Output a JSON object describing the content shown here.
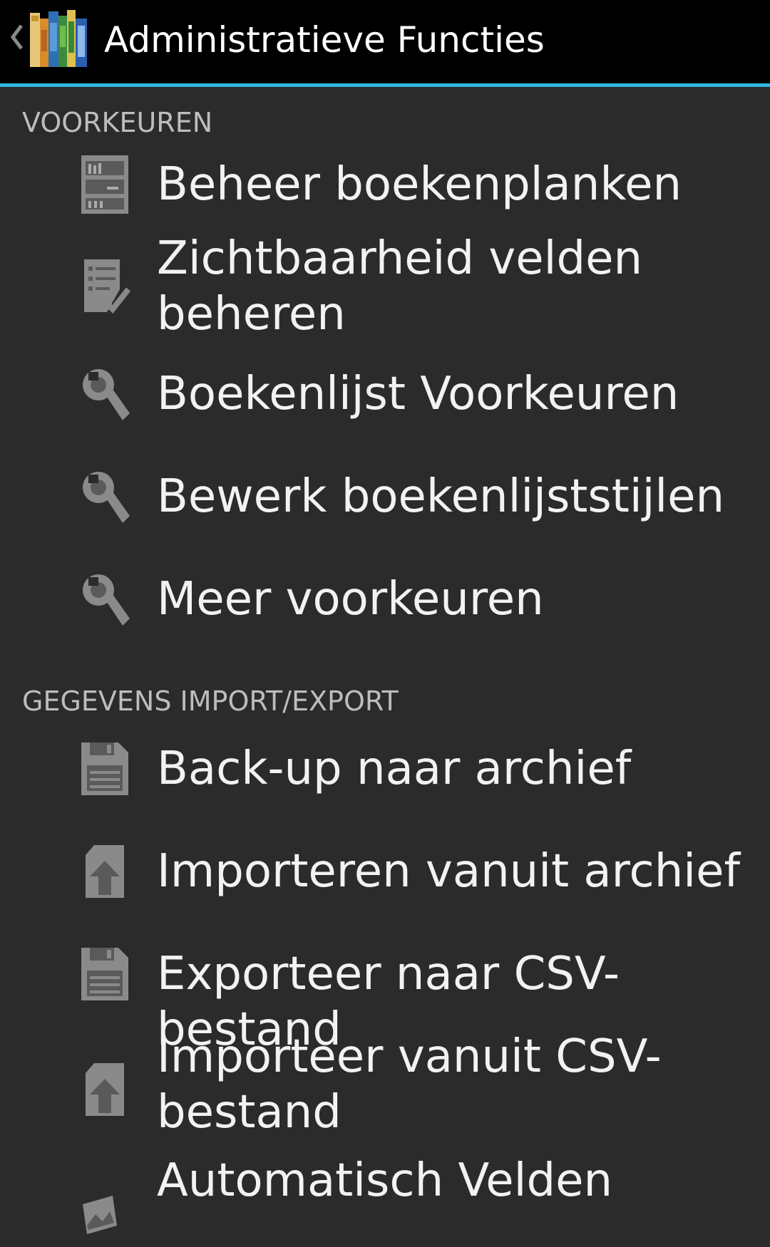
{
  "action_bar": {
    "title": "Administratieve Functies",
    "back_icon": "chevron-left-icon",
    "app_icon": "bookshelf-app-icon"
  },
  "sections": [
    {
      "header": "VOORKEUREN",
      "items": [
        {
          "label": "Beheer boekenplanken",
          "icon": "bookshelf-icon"
        },
        {
          "label": "Zichtbaarheid velden beheren",
          "icon": "checklist-icon"
        },
        {
          "label": "Boekenlijst Voorkeuren",
          "icon": "wrench-icon"
        },
        {
          "label": "Bewerk boekenlijststijlen",
          "icon": "wrench-icon"
        },
        {
          "label": "Meer voorkeuren",
          "icon": "wrench-icon"
        }
      ]
    },
    {
      "header": "GEGEVENS IMPORT/EXPORT",
      "items": [
        {
          "label": "Back-up naar archief",
          "icon": "floppy-disk-icon"
        },
        {
          "label": "Importeren vanuit archief",
          "icon": "import-icon"
        },
        {
          "label": "Exporteer naar CSV-bestand",
          "icon": "floppy-disk-icon"
        },
        {
          "label": "Importeer vanuit CSV-bestand",
          "icon": "import-icon"
        },
        {
          "label": "Automatisch Velden",
          "icon": "image-icon"
        }
      ]
    }
  ],
  "colors": {
    "background": "#2b2b2b",
    "action_bar": "#000000",
    "accent": "#33b5e5",
    "section_header": "#bdbdbd",
    "item_text": "#f2f2f2",
    "icon": "#8a8a8a"
  }
}
